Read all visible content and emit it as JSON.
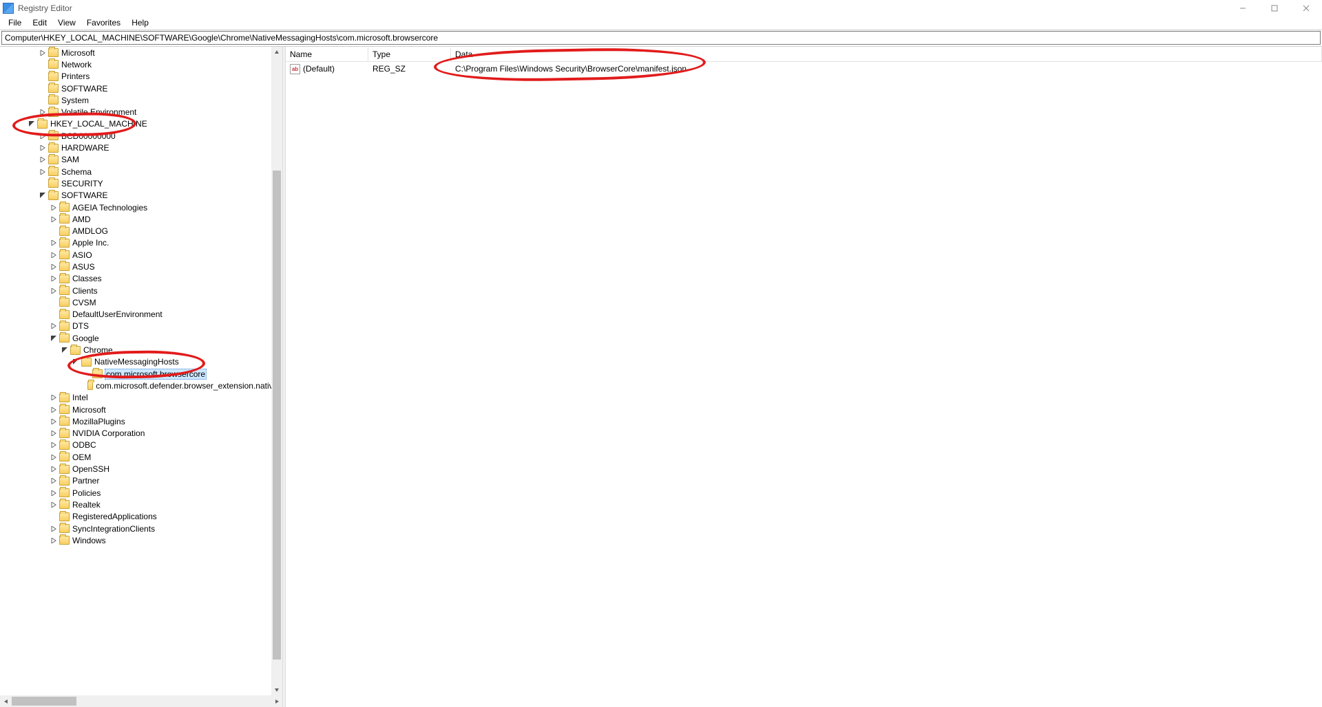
{
  "window": {
    "title": "Registry Editor"
  },
  "menu": {
    "file": "File",
    "edit": "Edit",
    "view": "View",
    "favorites": "Favorites",
    "help": "Help"
  },
  "address": "Computer\\HKEY_LOCAL_MACHINE\\SOFTWARE\\Google\\Chrome\\NativeMessagingHosts\\com.microsoft.browsercore",
  "headers": {
    "name": "Name",
    "type": "Type",
    "data": "Data"
  },
  "values": [
    {
      "name": "(Default)",
      "type": "REG_SZ",
      "data": "C:\\Program Files\\Windows Security\\BrowserCore\\manifest.json"
    }
  ],
  "tree": [
    {
      "depth": 2,
      "label": "Microsoft",
      "exp": "closed"
    },
    {
      "depth": 2,
      "label": "Network",
      "exp": "leaf"
    },
    {
      "depth": 2,
      "label": "Printers",
      "exp": "leaf"
    },
    {
      "depth": 2,
      "label": "SOFTWARE",
      "exp": "leaf"
    },
    {
      "depth": 2,
      "label": "System",
      "exp": "leaf"
    },
    {
      "depth": 2,
      "label": "Volatile Environment",
      "exp": "closed"
    },
    {
      "depth": 1,
      "label": "HKEY_LOCAL_MACHINE",
      "exp": "open"
    },
    {
      "depth": 2,
      "label": "BCD00000000",
      "exp": "closed"
    },
    {
      "depth": 2,
      "label": "HARDWARE",
      "exp": "closed"
    },
    {
      "depth": 2,
      "label": "SAM",
      "exp": "closed"
    },
    {
      "depth": 2,
      "label": "Schema",
      "exp": "closed"
    },
    {
      "depth": 2,
      "label": "SECURITY",
      "exp": "leaf"
    },
    {
      "depth": 2,
      "label": "SOFTWARE",
      "exp": "open"
    },
    {
      "depth": 3,
      "label": "AGEIA Technologies",
      "exp": "closed"
    },
    {
      "depth": 3,
      "label": "AMD",
      "exp": "closed"
    },
    {
      "depth": 3,
      "label": "AMDLOG",
      "exp": "leaf"
    },
    {
      "depth": 3,
      "label": "Apple Inc.",
      "exp": "closed"
    },
    {
      "depth": 3,
      "label": "ASIO",
      "exp": "closed"
    },
    {
      "depth": 3,
      "label": "ASUS",
      "exp": "closed"
    },
    {
      "depth": 3,
      "label": "Classes",
      "exp": "closed"
    },
    {
      "depth": 3,
      "label": "Clients",
      "exp": "closed"
    },
    {
      "depth": 3,
      "label": "CVSM",
      "exp": "leaf"
    },
    {
      "depth": 3,
      "label": "DefaultUserEnvironment",
      "exp": "leaf"
    },
    {
      "depth": 3,
      "label": "DTS",
      "exp": "closed"
    },
    {
      "depth": 3,
      "label": "Google",
      "exp": "open"
    },
    {
      "depth": 4,
      "label": "Chrome",
      "exp": "open"
    },
    {
      "depth": 5,
      "label": "NativeMessagingHosts",
      "exp": "open"
    },
    {
      "depth": 6,
      "label": "com.microsoft.browsercore",
      "exp": "leaf",
      "selected": true
    },
    {
      "depth": 6,
      "label": "com.microsoft.defender.browser_extension.native_",
      "exp": "leaf"
    },
    {
      "depth": 3,
      "label": "Intel",
      "exp": "closed"
    },
    {
      "depth": 3,
      "label": "Microsoft",
      "exp": "closed"
    },
    {
      "depth": 3,
      "label": "MozillaPlugins",
      "exp": "closed"
    },
    {
      "depth": 3,
      "label": "NVIDIA Corporation",
      "exp": "closed"
    },
    {
      "depth": 3,
      "label": "ODBC",
      "exp": "closed"
    },
    {
      "depth": 3,
      "label": "OEM",
      "exp": "closed"
    },
    {
      "depth": 3,
      "label": "OpenSSH",
      "exp": "closed"
    },
    {
      "depth": 3,
      "label": "Partner",
      "exp": "closed"
    },
    {
      "depth": 3,
      "label": "Policies",
      "exp": "closed"
    },
    {
      "depth": 3,
      "label": "Realtek",
      "exp": "closed"
    },
    {
      "depth": 3,
      "label": "RegisteredApplications",
      "exp": "leaf"
    },
    {
      "depth": 3,
      "label": "SyncIntegrationClients",
      "exp": "closed"
    },
    {
      "depth": 3,
      "label": "Windows",
      "exp": "closed"
    }
  ]
}
